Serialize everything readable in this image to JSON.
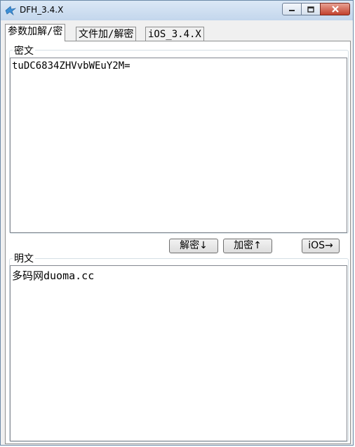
{
  "window": {
    "title": "DFH_3.4.X"
  },
  "tabs": [
    {
      "label": "参数加解/密",
      "active": true
    },
    {
      "label": "文件加/解密",
      "active": false
    },
    {
      "label": "iOS_3.4.X",
      "active": false
    }
  ],
  "cipher": {
    "label": "密文",
    "value": "tuDC6834ZHVvbWEuY2M="
  },
  "actions": {
    "decrypt_label": "解密↓",
    "encrypt_label": "加密↑",
    "ios_label": "iOS→"
  },
  "plain": {
    "label": "明文",
    "value": "多码网duoma.cc"
  },
  "colors": {
    "title_bar": "#c3d6ec",
    "close_button": "#c2412d",
    "panel_bg": "#ffffff"
  }
}
